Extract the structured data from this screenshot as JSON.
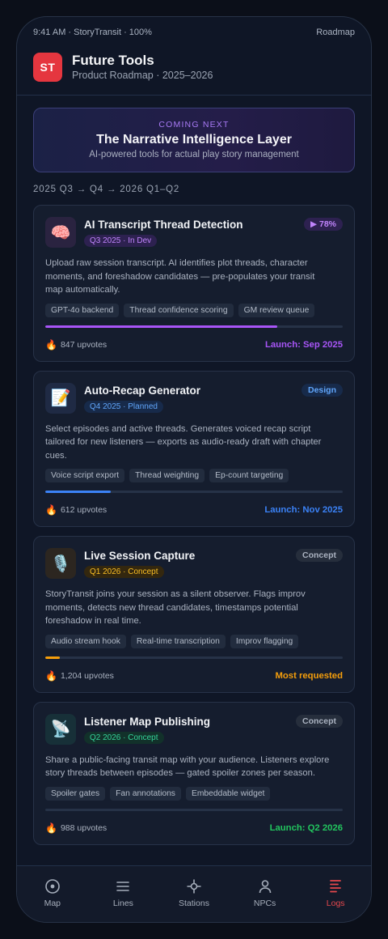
{
  "status": {
    "left": "9:41 AM · StoryTransit · 100%",
    "right": "Roadmap"
  },
  "header": {
    "logo": "ST",
    "title": "Future Tools",
    "subtitle": "Product Roadmap · 2025–2026"
  },
  "hero": {
    "eyebrow": "COMING NEXT",
    "title": "The Narrative Intelligence Layer",
    "subtitle": "AI-powered tools for actual play story management"
  },
  "timeline": "2025 Q3 → Q4 → 2026 Q1–Q2",
  "cards": [
    {
      "icon": "brain-icon",
      "glyph": "🧠",
      "title": "AI Transcript Thread Detection",
      "pill": "Q3 2025 · In Dev",
      "badge": "▶ 78%",
      "desc": "Upload raw session transcript. AI identifies plot threads, character moments, and foreshadow candidates — pre-populates your transit map automatically.",
      "tags": [
        "GPT-4o backend",
        "Thread confidence scoring",
        "GM review queue"
      ],
      "progress": 0.78,
      "upvotes": "847 upvotes",
      "launch": "Launch: Sep 2025",
      "accent": "#a855f7"
    },
    {
      "icon": "memo-icon",
      "glyph": "📝",
      "title": "Auto-Recap Generator",
      "pill": "Q4 2025 · Planned",
      "badge": "Design",
      "desc": "Select episodes and active threads. Generates voiced recap script tailored for new listeners — exports as audio-ready draft with chapter cues.",
      "tags": [
        "Voice script export",
        "Thread weighting",
        "Ep-count targeting"
      ],
      "progress": 0.22,
      "upvotes": "612 upvotes",
      "launch": "Launch: Nov 2025",
      "accent": "#3b82f6"
    },
    {
      "icon": "microphone-icon",
      "glyph": "🎙️",
      "title": "Live Session Capture",
      "pill": "Q1 2026 · Concept",
      "badge": "Concept",
      "desc": "StoryTransit joins your session as a silent observer. Flags improv moments, detects new thread candidates, timestamps potential foreshadow in real time.",
      "tags": [
        "Audio stream hook",
        "Real-time transcription",
        "Improv flagging"
      ],
      "progress": 0.05,
      "upvotes": "1,204 upvotes",
      "launch": "Most requested",
      "accent": "#f59e0b"
    },
    {
      "icon": "satellite-icon",
      "glyph": "📡",
      "title": "Listener Map Publishing",
      "pill": "Q2 2026 · Concept",
      "badge": "Concept",
      "desc": "Share a public-facing transit map with your audience. Listeners explore story threads between episodes — gated spoiler zones per season.",
      "tags": [
        "Spoiler gates",
        "Fan annotations",
        "Embeddable widget"
      ],
      "progress": 0.0,
      "upvotes": "988 upvotes",
      "launch": "Launch: Q2 2026",
      "accent": "#22c55e"
    }
  ],
  "nav": [
    {
      "label": "Map",
      "icon": "map-target-icon",
      "active": false
    },
    {
      "label": "Lines",
      "icon": "lines-icon",
      "active": false
    },
    {
      "label": "Stations",
      "icon": "stations-icon",
      "active": false
    },
    {
      "label": "NPCs",
      "icon": "person-icon",
      "active": false
    },
    {
      "label": "Logs",
      "icon": "logs-icon",
      "active": true
    }
  ],
  "colors": {
    "accent_red": "#e5363f",
    "purple": "#a855f7",
    "blue": "#3b82f6",
    "amber": "#f59e0b",
    "green": "#22c55e"
  }
}
